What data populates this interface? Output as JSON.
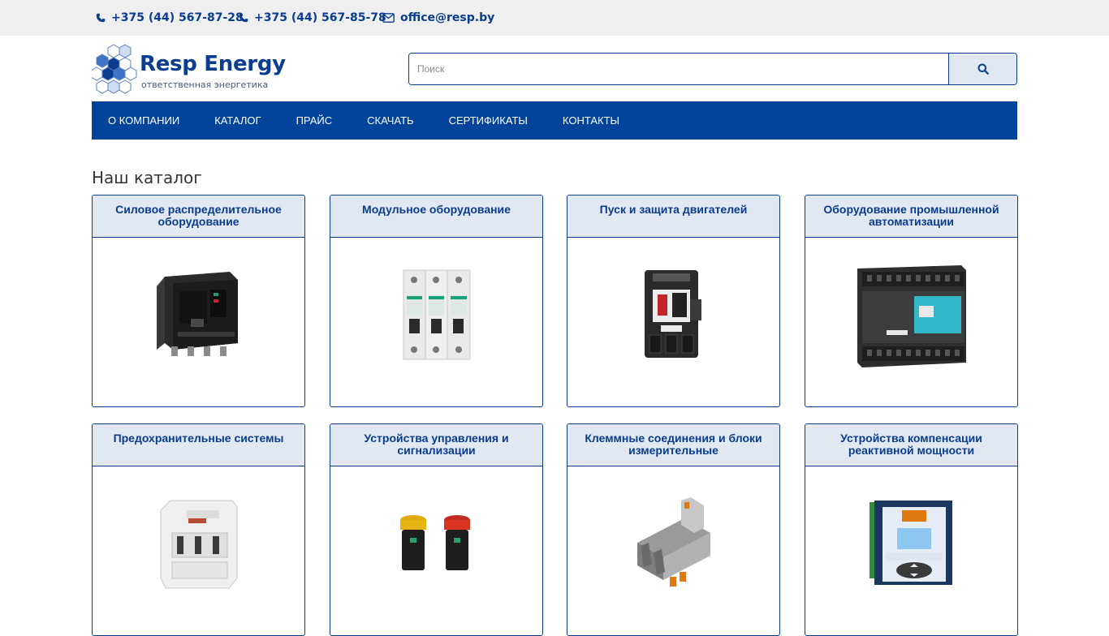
{
  "topbar": {
    "phone1": "+375 (44) 567-87-28",
    "phone2": "+375 (44) 567-85-78",
    "email": "office@resp.by"
  },
  "logo": {
    "brand": "Resp Energy",
    "tagline": "ответственная энергетика"
  },
  "search": {
    "placeholder": "Поиск"
  },
  "nav": {
    "items": [
      "О КОМПАНИИ",
      "КАТАЛОГ",
      "ПРАЙС",
      "СКАЧАТЬ",
      "СЕРТИФИКАТЫ",
      "КОНТАКТЫ"
    ]
  },
  "catalog": {
    "heading": "Наш каталог",
    "cards": [
      {
        "title": "Силовое распределительное оборудование",
        "icon": "air-circuit-breaker-image"
      },
      {
        "title": "Модульное оборудование",
        "icon": "modular-breaker-image"
      },
      {
        "title": "Пуск и защита двигателей",
        "icon": "motor-protection-switch-image"
      },
      {
        "title": "Оборудование промышленной автоматизации",
        "icon": "plc-controller-image"
      },
      {
        "title": "Предохранительные системы",
        "icon": "fuse-switch-image"
      },
      {
        "title": "Устройства управления и сигнализации",
        "icon": "indicator-lamps-image"
      },
      {
        "title": "Клеммные соединения и блоки измерительные",
        "icon": "terminal-block-image"
      },
      {
        "title": "Устройства компенсации реактивной мощности",
        "icon": "power-factor-controller-image"
      }
    ]
  },
  "colors": {
    "brand": "#0a3d8f",
    "nav_bg": "#02449b",
    "card_header_bg": "#e1e8f2",
    "topbar_bg": "#efefef"
  }
}
